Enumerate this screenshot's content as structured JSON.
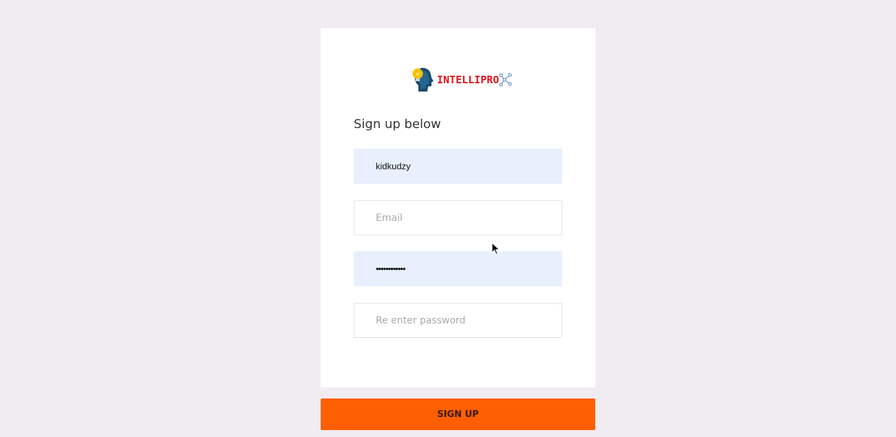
{
  "brand": {
    "name": "INTELLIPRO",
    "logo_icon": "head-lightbulb-icon",
    "network_icon": "network-nodes-icon",
    "color": "#e1141c"
  },
  "form": {
    "heading": "Sign up below",
    "username_value": "kidkudzy",
    "email_placeholder": "Email",
    "password_value": "••••••••••••",
    "confirm_placeholder": "Re enter password"
  },
  "signup_button": {
    "label": "SIGN UP",
    "color": "#ff5f00"
  }
}
